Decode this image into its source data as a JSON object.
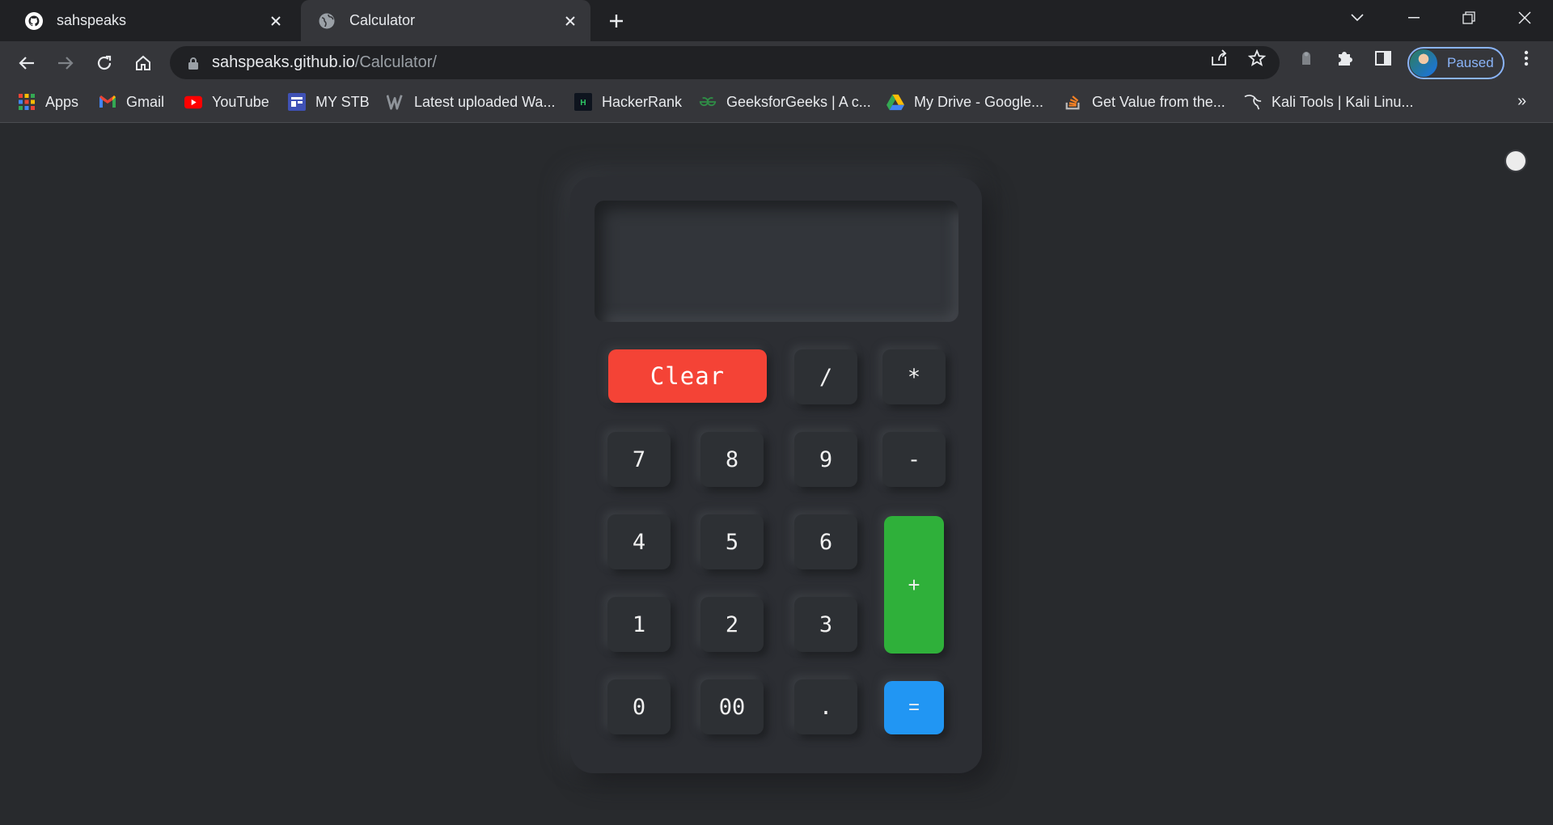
{
  "browser": {
    "tabs": [
      {
        "title": "sahspeaks",
        "icon": "github-icon",
        "active": false
      },
      {
        "title": "Calculator",
        "icon": "globe-icon",
        "active": true
      }
    ],
    "url": {
      "host": "sahspeaks.github.io",
      "path": "/Calculator/"
    },
    "profile_label": "Paused",
    "bookmarks": [
      {
        "label": "Apps",
        "icon": "apps-grid-icon"
      },
      {
        "label": "Gmail",
        "icon": "gmail-icon"
      },
      {
        "label": "YouTube",
        "icon": "youtube-icon"
      },
      {
        "label": "MY STB",
        "icon": "stb-icon"
      },
      {
        "label": "Latest uploaded Wa...",
        "icon": "w-logo-icon"
      },
      {
        "label": "HackerRank",
        "icon": "hackerrank-icon"
      },
      {
        "label": "GeeksforGeeks | A c...",
        "icon": "geeksforgeeks-icon"
      },
      {
        "label": "My Drive - Google...",
        "icon": "google-drive-icon"
      },
      {
        "label": "Get Value from the...",
        "icon": "stackoverflow-icon"
      },
      {
        "label": "Kali Tools | Kali Linu...",
        "icon": "kali-dragon-icon"
      }
    ],
    "overflow_label": "»"
  },
  "calculator": {
    "display_value": "",
    "keys": {
      "clear": "Clear",
      "divide": "/",
      "multiply": "*",
      "seven": "7",
      "eight": "8",
      "nine": "9",
      "minus": "-",
      "four": "4",
      "five": "5",
      "six": "6",
      "plus": "+",
      "one": "1",
      "two": "2",
      "three": "3",
      "zero": "0",
      "double_zero": "00",
      "dot": ".",
      "equals": "="
    },
    "colors": {
      "clear": "#f44336",
      "plus": "#2fb03a",
      "equals": "#2196f3",
      "body": "#2c2e33"
    }
  }
}
